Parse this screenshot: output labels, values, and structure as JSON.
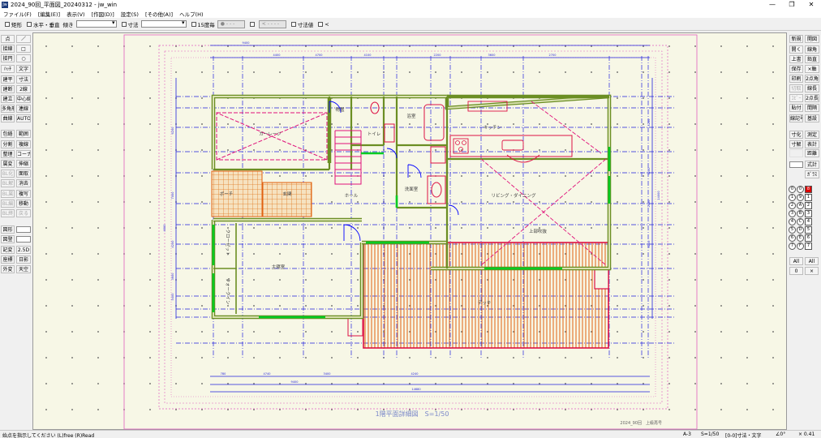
{
  "window": {
    "app_icon": "Jw",
    "title": "2024_90回_平面図_20240312 - jw_win",
    "min": "—",
    "max": "❐",
    "close": "✕"
  },
  "menu": [
    "ファイル(F)",
    "[編集(E)]",
    "表示(V)",
    "[作図(D)]",
    "設定(S)",
    "[その他(A)]",
    "ヘルプ(H)"
  ],
  "toolbar": {
    "rect": "矩形",
    "hv": "水平・垂直",
    "slope": "傾き",
    "dim": "寸法",
    "deg15": "15度毎",
    "btn1": "● - - -",
    "btn2": "< - - - -",
    "dimval": "寸法値",
    "arrow": "<"
  },
  "left_tools": [
    [
      "点",
      "／"
    ],
    [
      "接線",
      "□"
    ],
    [
      "接円",
      "○"
    ],
    [
      "ﾊｯﾁ",
      "文字"
    ],
    [
      "建平",
      "寸法"
    ],
    [
      "建断",
      "2線"
    ],
    [
      "建立",
      "中心線"
    ],
    [
      "多角形",
      "連線"
    ],
    [
      "曲線",
      "AUTO"
    ],
    [
      "包絡",
      "範囲"
    ],
    [
      "分割",
      "複線"
    ],
    [
      "整理",
      "コーナー"
    ],
    [
      "属変",
      "伸縮"
    ],
    [
      "BL化",
      "面取"
    ],
    [
      "BL解",
      "消去"
    ],
    [
      "BL属",
      "複写"
    ],
    [
      "BL編",
      "移動"
    ],
    [
      "BL終",
      "戻る"
    ],
    [
      "図形",
      ""
    ],
    [
      "図登",
      ""
    ],
    [
      "記変",
      "2.5D"
    ],
    [
      "座標",
      "日影"
    ],
    [
      "外変",
      "天空"
    ]
  ],
  "right_tools": [
    [
      "新規",
      "開図"
    ],
    [
      "開く",
      "線角"
    ],
    [
      "上書",
      "鉛直"
    ],
    [
      "保存",
      "×軸"
    ],
    [
      "印刷",
      "2点角"
    ],
    [
      "切取",
      "線長"
    ],
    [
      "ｺﾋﾟｰ",
      "2点長"
    ],
    [
      "貼付",
      "間隔"
    ],
    [
      "線記号",
      "基設"
    ],
    [
      "寸化",
      "測定"
    ],
    [
      "寸解",
      "表計"
    ],
    [
      "",
      "距離"
    ],
    [
      "",
      "式計"
    ],
    [
      "",
      "ｶﾞﾗｽ"
    ]
  ],
  "right_layers": {
    "rows": [
      [
        "0",
        "0",
        "8"
      ],
      [
        "1",
        "9",
        "1"
      ],
      [
        "2",
        "A",
        "2"
      ],
      [
        "3",
        "B",
        "3"
      ],
      [
        "4",
        "C",
        "4"
      ],
      [
        "5",
        "D",
        "5"
      ],
      [
        "6",
        "E",
        "6"
      ],
      [
        "7",
        "F",
        "7"
      ]
    ],
    "all1": "All",
    "all2": "All",
    "zero": "0",
    "x": "×"
  },
  "statusbar": {
    "message": "始点を指示してください (L)free (R)Read",
    "paper": "A-3",
    "scale": "S=1/50",
    "layer": "[0-0]寸法・文字",
    "angle": "∠0°",
    "zoom": "× 0.41"
  },
  "drawing": {
    "title": "1階平面詳細図　S=1/50",
    "author": "2024_90回　上級再号",
    "rooms": {
      "garage": "ガーレージ",
      "storage": "物置",
      "toilet": "トイレ",
      "bath": "浴室",
      "kitchen": "キッチン",
      "hall": "ホール",
      "wash": "洗面室",
      "living": "リビング・ダイニング",
      "porch": "ポーチ",
      "entrance": "玄関",
      "bedroom": "主寝室",
      "closet1": "クローゼット",
      "closet2": "ウォークイン",
      "deck": "デッキ",
      "ceiling": "上部吹抜"
    },
    "dims_top": [
      "9400",
      "4400",
      "4700",
      "4100",
      "2200",
      "3600",
      "2700"
    ],
    "dims_bottom": [
      "780",
      "4740",
      "3400",
      "4240",
      "14680",
      "9400"
    ],
    "dims_left": [
      "6200",
      "7000",
      "4200",
      "3600",
      "5400",
      "4800"
    ],
    "dims_right": [
      "4200",
      "3200",
      "2600",
      "4250",
      "14000"
    ],
    "colors": {
      "wall": "#6b8e23",
      "wall_fill": "#d8e0b0",
      "grid": "#2222dd",
      "border": "#e060c0",
      "stair": "#e0107a",
      "deck": "#e06010",
      "deck_frame": "#dd1144",
      "door": "#0000ff",
      "window": "#00cc22"
    }
  }
}
